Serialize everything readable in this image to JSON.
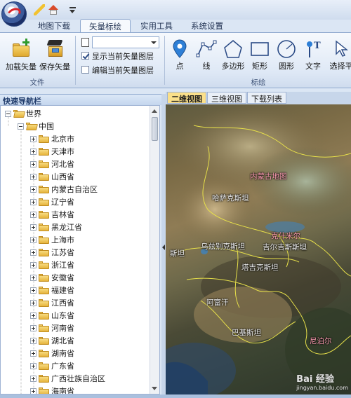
{
  "ribbon": {
    "tabs": [
      "地图下载",
      "矢量标绘",
      "实用工具",
      "系统设置"
    ],
    "active_tab": "矢量标绘",
    "load_vector_label": "加载矢量",
    "save_vector_label": "保存矢量",
    "group1_label": "文件",
    "show_layer_label": "显示当前矢量图层",
    "edit_layer_label": "编辑当前矢量图层",
    "show_layer_checked": true,
    "edit_layer_checked": false,
    "layer_combo_value": "",
    "draw_group_label": "标绘",
    "tools": [
      {
        "label": "点",
        "icon": "point-marker-icon"
      },
      {
        "label": "线",
        "icon": "line-icon"
      },
      {
        "label": "多边形",
        "icon": "polygon-icon"
      },
      {
        "label": "矩形",
        "icon": "rectangle-icon"
      },
      {
        "label": "圆形",
        "icon": "circle-icon"
      },
      {
        "label": "文字",
        "icon": "text-icon"
      },
      {
        "label": "选择平",
        "icon": "select-icon"
      }
    ]
  },
  "nav": {
    "title": "快速导航栏",
    "root": "世界",
    "country": "中国",
    "provinces": [
      "北京市",
      "天津市",
      "河北省",
      "山西省",
      "内蒙古自治区",
      "辽宁省",
      "吉林省",
      "黑龙江省",
      "上海市",
      "江苏省",
      "浙江省",
      "安徽省",
      "福建省",
      "江西省",
      "山东省",
      "河南省",
      "湖北省",
      "湖南省",
      "广东省",
      "广西壮族自治区",
      "海南省"
    ]
  },
  "map": {
    "tabs": [
      "二维视图",
      "三维视图",
      "下载列表"
    ],
    "active_tab": "二维视图",
    "labels": [
      "内蒙古地图",
      "哈萨克斯坦",
      "乌兹别克斯坦",
      "吉尔吉斯斯坦",
      "塔吉克斯坦",
      "斯坦",
      "阿富汗",
      "巴基斯坦",
      "克什米尔",
      "尼泊尔"
    ]
  },
  "watermark": {
    "text": "Bai 经验",
    "sub": "jingyan.baidu.com"
  },
  "colors": {
    "ribbon_border": "#8fa9cf",
    "active_map_tab": "#fbe08a",
    "map_label_pink": "#ff9db3",
    "border_yellow": "#e7e04a"
  }
}
